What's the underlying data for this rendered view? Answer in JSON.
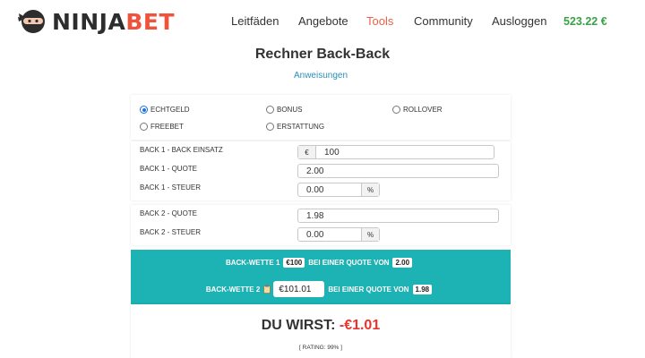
{
  "brand": {
    "name_part1": "NINJA",
    "name_part2": "BET"
  },
  "nav": {
    "items": [
      {
        "label": "Leitfäden"
      },
      {
        "label": "Angebote"
      },
      {
        "label": "Tools",
        "active": true
      },
      {
        "label": "Community"
      },
      {
        "label": "Ausloggen"
      }
    ],
    "balance": "523.22 €"
  },
  "page": {
    "title": "Rechner Back-Back",
    "instructions_link": "Anweisungen"
  },
  "bet_types": {
    "options": [
      {
        "label": "ECHTGELD",
        "checked": true
      },
      {
        "label": "BONUS",
        "checked": false
      },
      {
        "label": "ROLLOVER",
        "checked": false
      },
      {
        "label": "FREEBET",
        "checked": false
      },
      {
        "label": "ERSTATTUNG",
        "checked": false
      }
    ]
  },
  "back1": {
    "stake_label": "BACK 1 - BACK EINSATZ",
    "currency": "€",
    "stake_value": "100",
    "odds_label": "BACK 1 - QUOTE",
    "odds_value": "2.00",
    "tax_label": "BACK 1 - STEUER",
    "tax_value": "0.00",
    "tax_unit": "%"
  },
  "back2": {
    "odds_label": "BACK 2 - QUOTE",
    "odds_value": "1.98",
    "tax_label": "BACK 2 - STEUER",
    "tax_value": "0.00",
    "tax_unit": "%"
  },
  "result": {
    "line1_prefix": "BACK-WETTE 1",
    "line1_stake": "€100",
    "line1_mid": "BEI EINER QUOTE VON",
    "line1_odds": "2.00",
    "line2_prefix": "BACK-WETTE 2",
    "line2_stake": "€101.01",
    "line2_mid": "BEI EINER QUOTE VON",
    "line2_odds": "1.98"
  },
  "outcome": {
    "prefix": "DU WIRST:",
    "amount": "-€1.01",
    "rating": "[ RATING: 99% ]"
  },
  "colors": {
    "brand_accent": "#f0533b",
    "active_nav": "#e8624a",
    "balance": "#3aa047",
    "result_band": "#1db2b3",
    "loss": "#e8342c",
    "link": "#2a8fb8"
  }
}
